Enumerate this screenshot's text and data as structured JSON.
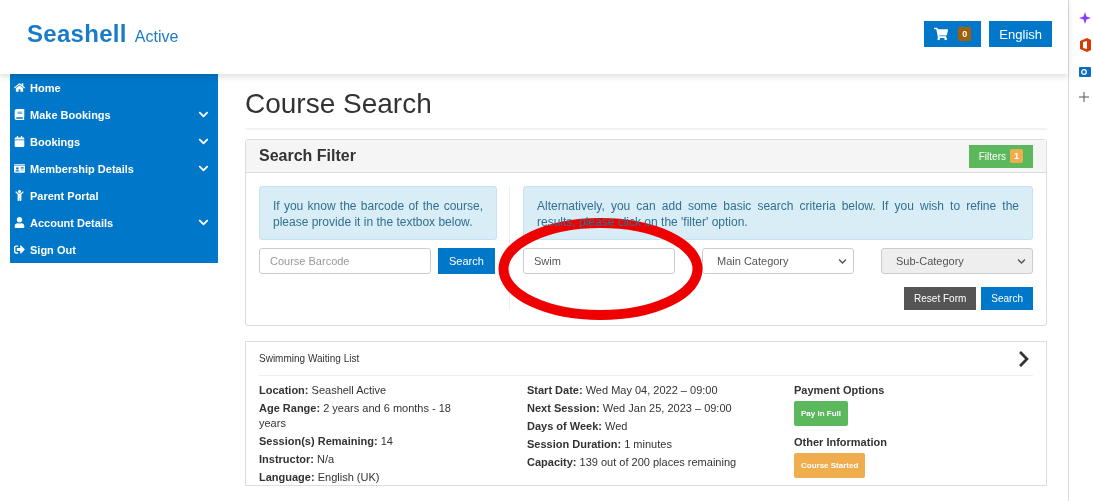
{
  "header": {
    "logo": {
      "brand": "Seashell",
      "suffix": "Active"
    },
    "cart_count": "0",
    "language": "English"
  },
  "sidebar": {
    "items": [
      {
        "label": "Home",
        "has_submenu": false
      },
      {
        "label": "Make Bookings",
        "has_submenu": true
      },
      {
        "label": "Bookings",
        "has_submenu": true
      },
      {
        "label": "Membership Details",
        "has_submenu": true
      },
      {
        "label": "Parent Portal",
        "has_submenu": false
      },
      {
        "label": "Account Details",
        "has_submenu": true
      },
      {
        "label": "Sign Out",
        "has_submenu": false
      }
    ]
  },
  "page_title": "Course Search",
  "search_filter": {
    "title": "Search Filter",
    "filters_button": "Filters",
    "filters_count": "1",
    "barcode_info": "If you know the barcode of the course, please provide it in the textbox below.",
    "barcode_placeholder": "Course Barcode",
    "barcode_search": "Search",
    "criteria_info": "Alternatively, you can add some basic search criteria below. If you wish to refine the results, please click on the 'filter' option.",
    "keyword_value": "Swim",
    "selects": [
      {
        "value": "Main Category",
        "disabled": false
      },
      {
        "value": "Sub-Category",
        "disabled": true
      }
    ],
    "reset_button": "Reset Form",
    "search_button": "Search"
  },
  "course": {
    "title": "Swimming Waiting List",
    "columns": [
      [
        {
          "label": "Location:",
          "value": "Seashell Active"
        },
        {
          "label": "Age Range:",
          "value": "2 years and 6 months - 18 years"
        },
        {
          "label": "Session(s) Remaining:",
          "value": "14"
        },
        {
          "label": "Instructor:",
          "value": "N/a"
        },
        {
          "label": "Language:",
          "value": "English (UK)"
        }
      ],
      [
        {
          "label": "Start Date:",
          "value": "Wed May 04, 2022 – 09:00"
        },
        {
          "label": "Next Session:",
          "value": "Wed Jan 25, 2023 – 09:00"
        },
        {
          "label": "Days of Week:",
          "value": "Wed"
        },
        {
          "label": "Session Duration:",
          "value": "1 minutes"
        },
        {
          "label": "Capacity:",
          "value": "139 out of 200 places remaining"
        }
      ]
    ],
    "sections": [
      {
        "heading": "Payment Options",
        "badge": "Pay in Full",
        "color": "#5cb85c"
      },
      {
        "heading": "Other Information",
        "badge": "Course Started",
        "color": "#f0ad4e"
      }
    ]
  }
}
